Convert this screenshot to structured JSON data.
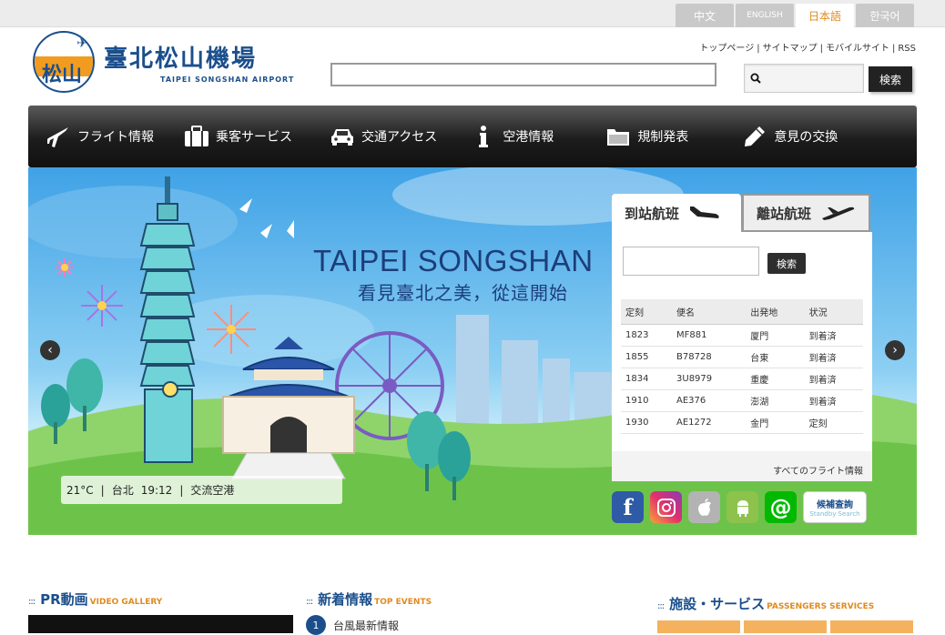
{
  "languages": [
    {
      "label": "中文",
      "active": false
    },
    {
      "label": "ENGLISH",
      "active": false
    },
    {
      "label": "日本語",
      "active": true
    },
    {
      "label": "한국어",
      "active": false
    }
  ],
  "logo": {
    "title": "臺北松山機場",
    "subtitle": "TAIPEI SONGSHAN AIRPORT",
    "badge_text": "松山"
  },
  "util_links": [
    "トップページ",
    "サイトマップ",
    "モバイルサイト",
    "RSS"
  ],
  "search": {
    "button_label": "検索"
  },
  "nav": [
    {
      "label": "フライト情報",
      "icon": "airplane-icon"
    },
    {
      "label": "乗客サービス",
      "icon": "briefcase-icon"
    },
    {
      "label": "交通アクセス",
      "icon": "car-icon"
    },
    {
      "label": "空港情報",
      "icon": "info-icon"
    },
    {
      "label": "規制発表",
      "icon": "folder-icon"
    },
    {
      "label": "意見の交換",
      "icon": "pencil-icon"
    }
  ],
  "hero": {
    "title": "TAIPEI SONGSHAN",
    "subtitle": "看見臺北之美，從這開始",
    "weather": {
      "temp": "21°C",
      "city": "台北",
      "time": "19:12",
      "condition": "交流空港"
    }
  },
  "flight_panel": {
    "tab_arrival": "到站航班",
    "tab_departure": "離站航班",
    "search_button": "検索",
    "headers": [
      "定刻",
      "便名",
      "出発地",
      "状況"
    ],
    "rows": [
      [
        "1823",
        "MF881",
        "厦門",
        "到着済"
      ],
      [
        "1855",
        "B78728",
        "台東",
        "到着済"
      ],
      [
        "1834",
        "3U8979",
        "重慶",
        "到着済"
      ],
      [
        "1910",
        "AE376",
        "澎湖",
        "到着済"
      ],
      [
        "1930",
        "AE1272",
        "金門",
        "定刻"
      ]
    ],
    "all_flights": "すべてのフライト情報"
  },
  "social": {
    "standby_main": "候補查詢",
    "standby_sub": "Standby Search"
  },
  "sections": {
    "video": {
      "main": "PR動画",
      "sub": "VIDEO GALLERY"
    },
    "news": {
      "main": "新着情報",
      "sub": "TOP EVENTS"
    },
    "services": {
      "main": "施設・サービス",
      "sub": "PASSENGERS SERVICES"
    }
  },
  "news_items": [
    {
      "num": "1",
      "text": "台風最新情報"
    }
  ]
}
